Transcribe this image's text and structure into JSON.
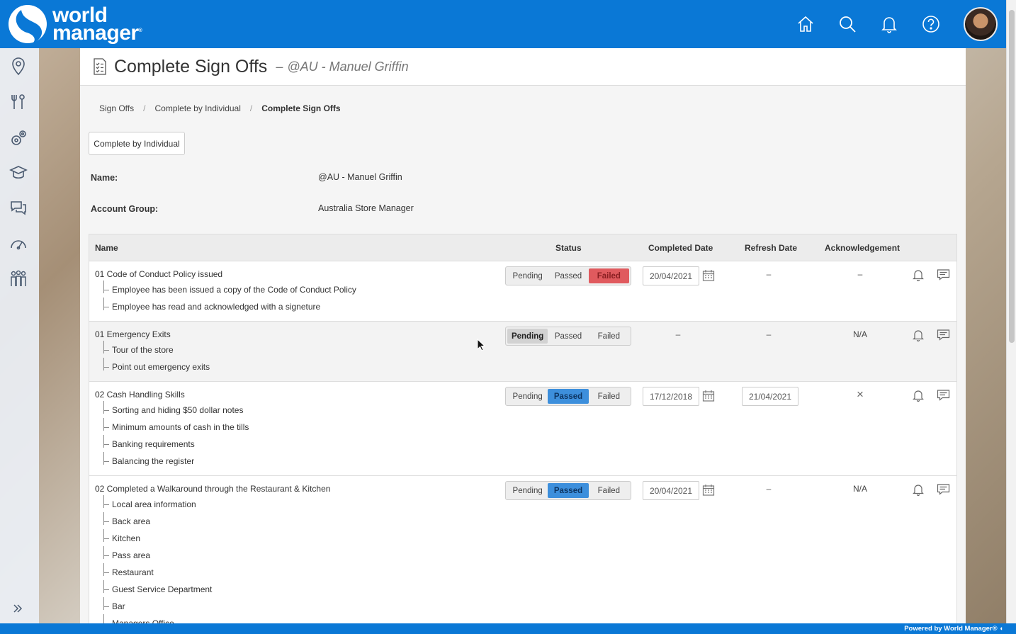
{
  "app": {
    "logo_line1": "world",
    "logo_line2": "manager",
    "footer": "Powered by World Manager®"
  },
  "header_icons": [
    "home-icon",
    "search-icon",
    "bell-icon",
    "help-icon"
  ],
  "sidebar_icons": [
    "map-pin-icon",
    "tools-icon",
    "gears-icon",
    "learning-icon",
    "chat-icon",
    "speedometer-icon",
    "people-icon"
  ],
  "page": {
    "title": "Complete Sign Offs",
    "subtitle_dash": "–",
    "subtitle": "@AU - Manuel Griffin"
  },
  "breadcrumb": {
    "items": [
      "Sign Offs",
      "Complete by Individual"
    ],
    "current": "Complete Sign Offs",
    "separator": "/"
  },
  "actions": {
    "complete_by_individual": "Complete by Individual"
  },
  "info": {
    "name_label": "Name:",
    "name_value": "@AU - Manuel Griffin",
    "group_label": "Account Group:",
    "group_value": "Australia Store Manager"
  },
  "table": {
    "headers": {
      "name": "Name",
      "status": "Status",
      "completed_date": "Completed Date",
      "refresh_date": "Refresh Date",
      "acknowledgement": "Acknowledgement"
    },
    "status_options": [
      "Pending",
      "Passed",
      "Failed"
    ],
    "dash": "–",
    "rows": [
      {
        "title": "01 Code of Conduct Policy issued",
        "subs": [
          "Employee has been issued a copy of the Code of Conduct Policy",
          "Employee has read and acknowledged with a signeture"
        ],
        "status": "Failed",
        "completed": "20/04/2021",
        "refresh": "–",
        "ack": "–"
      },
      {
        "title": "01 Emergency Exits",
        "subs": [
          "Tour of the store",
          "Point out emergency exits"
        ],
        "status": "Pending",
        "completed": "–",
        "refresh": "–",
        "ack": "N/A"
      },
      {
        "title": "02 Cash Handling Skills",
        "subs": [
          "Sorting and hiding $50 dollar notes",
          "Minimum amounts of cash in the tills",
          "Banking requirements",
          "Balancing the register"
        ],
        "status": "Passed",
        "completed": "17/12/2018",
        "refresh": "21/04/2021",
        "ack": "×"
      },
      {
        "title": "02 Completed a Walkaround through the Restaurant & Kitchen",
        "subs": [
          "Local area information",
          "Back area",
          "Kitchen",
          "Pass area",
          "Restaurant",
          "Guest Service Department",
          "Bar",
          "Managers Office"
        ],
        "status": "Passed",
        "completed": "20/04/2021",
        "refresh": "–",
        "ack": "N/A"
      }
    ]
  },
  "colors": {
    "brand_blue": "#0a78d6",
    "failed_red": "#e05a5e",
    "passed_blue": "#3d8fdc",
    "pending_grey": "#d2d2d2"
  }
}
